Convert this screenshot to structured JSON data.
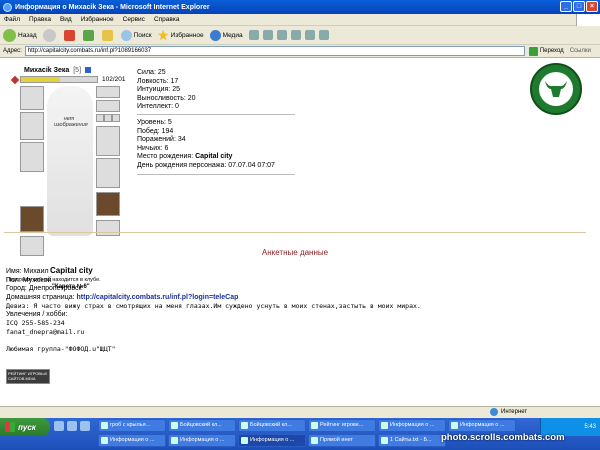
{
  "window": {
    "title": "Информация о Mихасik Зека - Microsoft Internet Explorer",
    "min": "_",
    "max": "□",
    "close": "×"
  },
  "menu": [
    "Файл",
    "Правка",
    "Вид",
    "Избранное",
    "Сервис",
    "Справка"
  ],
  "toolbar": {
    "back": "Назад",
    "search": "Поиск",
    "favorites": "Избранное",
    "media": "Медиа"
  },
  "address": {
    "label": "Адрес:",
    "url": "http://capitalcity.combats.ru/inf.pl?1089166037",
    "go": "Переход",
    "links": "Ссылки"
  },
  "character": {
    "name": "Mихасik Зека",
    "level": "[5]",
    "hp_text": "102/201",
    "hp_fraction": 0.507,
    "no_image_text": "нет изображения",
    "city": "Capital city",
    "club_line": "Персонаж сейчас находится в клубе.",
    "club_room": "\"Карета №6\""
  },
  "stats": [
    "Сила: 25",
    "Ловкость: 17",
    "Интуиция: 25",
    "Выносливость: 20",
    "Интеллект: 0"
  ],
  "record": {
    "level": "Уровень: 5",
    "wins": "Побед: 194",
    "losses": "Поражений: 34",
    "draws": "Ничьих: 6",
    "birthplace_label": "Место рождения:",
    "birthplace_value": "Capital city",
    "birthday": "День рождения персонажа: 07.07.04 07:07"
  },
  "profile": {
    "section_title": "Анкетные данные",
    "name": "Имя: Михаил",
    "gender": "Пол: Мужской",
    "city": "Город: Днепропетровск",
    "homepage_label": "Домашняя страница:",
    "homepage_url": "http://capitalcity.combats.ru/inf.pl?login=teleCap",
    "motto": "Девиз: Я часто вижу страх в смотрящих на меня глазах.Им суждено уснуть в моих стенах,застыть в моих мирах.",
    "hobbies_label": "Увлечения / хобби:",
    "icq": "ICQ 255-585-234",
    "email": "fanat_dnepra@mail.ru",
    "fav_group": "Любимая группа-\"ФОФОД.u\"ЩЦТ\""
  },
  "counter_text": "РЕЙТИНГ ИГРОВЫХ САЙТОВ MDIA",
  "status": {
    "zone": "Интернет"
  },
  "taskbar": {
    "start": "пуск",
    "tasks": [
      "гроб с крылья...",
      "Бойцовский кл...",
      "Бойцовский кл...",
      "Рейтинг игрове...",
      "Информация о ...",
      "Информация о ...",
      "Информация о ...",
      "Информация о ...",
      "Информация о ...",
      "Прямой инет",
      "1 Сайты.txt - Б..."
    ],
    "clock": "5:43"
  },
  "watermark": "photo.scrolls.combats.com"
}
